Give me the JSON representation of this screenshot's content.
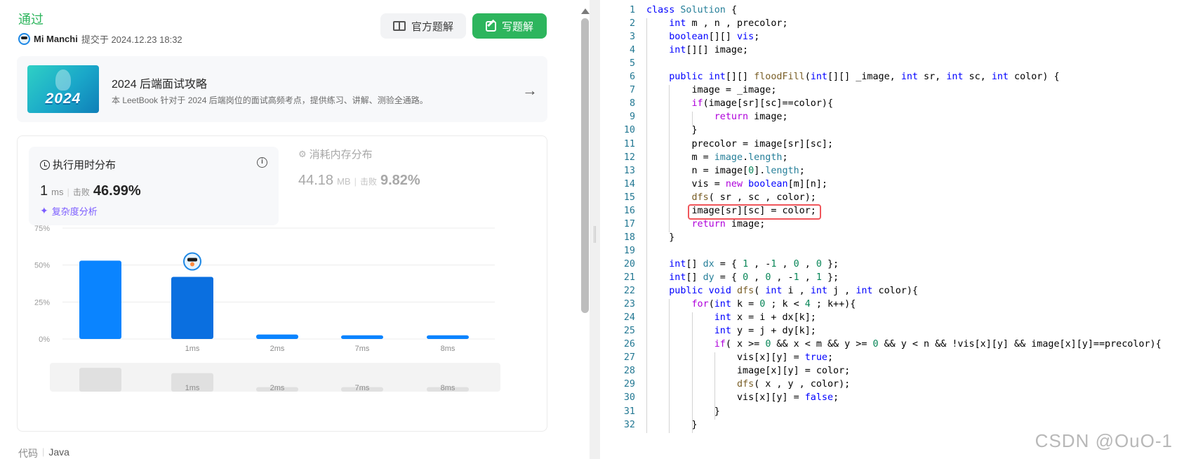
{
  "submission": {
    "status": "通过",
    "user": "Mi Manchi",
    "submitted_at": "提交于 2024.12.23 18:32"
  },
  "actions": {
    "official_solution": "官方题解",
    "write_solution": "写题解"
  },
  "leetbook": {
    "cover_text": "2024",
    "title": "2024 后端面试攻略",
    "description": "本 LeetBook 针对于 2024 后端岗位的面试高频考点，提供练习、讲解、测验全通路。"
  },
  "runtime": {
    "title": "执行用时分布",
    "value": "1",
    "unit": "ms",
    "beat_label": "击败",
    "beat_pct": "46.99%",
    "complexity_link": "复杂度分析"
  },
  "memory": {
    "title": "消耗内存分布",
    "value": "44.18",
    "unit": "MB",
    "beat_label": "击败",
    "beat_pct": "9.82%"
  },
  "chart_data": {
    "type": "bar",
    "categories": [
      "",
      "1ms",
      "2ms",
      "7ms",
      "8ms"
    ],
    "values": [
      53,
      42,
      3,
      2.5,
      2.5
    ],
    "y_ticks": [
      "75%",
      "50%",
      "25%",
      "0%"
    ],
    "ylim": [
      0,
      75
    ],
    "highlight_index": 1,
    "colors": {
      "bar": "#0a84ff",
      "bar_highlight": "#0a6fe0",
      "overview": "#e0e0e0"
    },
    "overview_values": [
      32,
      25,
      6,
      6,
      6
    ],
    "overview_labels": [
      "",
      "1ms",
      "2ms",
      "7ms",
      "8ms"
    ]
  },
  "footer": {
    "code_label": "代码",
    "language": "Java"
  },
  "editor": {
    "watermark": "CSDN @OuO-1",
    "lines": [
      {
        "n": "1",
        "t": [
          [
            "kw",
            "class "
          ],
          [
            "ty",
            "Solution "
          ],
          [
            "",
            "{"
          ]
        ]
      },
      {
        "n": "2",
        "t": [
          [
            "",
            "    "
          ],
          [
            "kw",
            "int"
          ],
          [
            "",
            " m , n , precolor;"
          ]
        ]
      },
      {
        "n": "3",
        "t": [
          [
            "",
            "    "
          ],
          [
            "kw",
            "boolean"
          ],
          [
            "",
            "[][] "
          ],
          [
            "kw",
            "vis"
          ],
          [
            "",
            ";"
          ]
        ]
      },
      {
        "n": "4",
        "t": [
          [
            "",
            "    "
          ],
          [
            "kw",
            "int"
          ],
          [
            "",
            "[][] image;"
          ]
        ]
      },
      {
        "n": "5",
        "t": [
          [
            "",
            ""
          ]
        ]
      },
      {
        "n": "6",
        "t": [
          [
            "",
            "    "
          ],
          [
            "kw",
            "public int"
          ],
          [
            "",
            "[][] "
          ],
          [
            "fn",
            "floodFill"
          ],
          [
            "",
            "("
          ],
          [
            "kw",
            "int"
          ],
          [
            "",
            "[][] _image, "
          ],
          [
            "kw",
            "int"
          ],
          [
            "",
            " sr, "
          ],
          [
            "kw",
            "int"
          ],
          [
            "",
            " sc, "
          ],
          [
            "kw",
            "int"
          ],
          [
            "",
            " color) {"
          ]
        ]
      },
      {
        "n": "7",
        "t": [
          [
            "",
            "        image = _image;"
          ]
        ]
      },
      {
        "n": "8",
        "t": [
          [
            "",
            "        "
          ],
          [
            "ctl",
            "if"
          ],
          [
            "",
            "(image[sr][sc]==color){"
          ]
        ]
      },
      {
        "n": "9",
        "t": [
          [
            "",
            "            "
          ],
          [
            "ctl",
            "return"
          ],
          [
            "",
            " image;"
          ]
        ]
      },
      {
        "n": "10",
        "t": [
          [
            "",
            "        }"
          ]
        ]
      },
      {
        "n": "11",
        "t": [
          [
            "",
            "        precolor = image[sr][sc];"
          ]
        ]
      },
      {
        "n": "12",
        "t": [
          [
            "",
            "        m = "
          ],
          [
            "ty",
            "image"
          ],
          [
            "",
            "."
          ],
          [
            "ty",
            "length"
          ],
          [
            "",
            ";"
          ]
        ]
      },
      {
        "n": "13",
        "t": [
          [
            "",
            "        n = image["
          ],
          [
            "nm",
            "0"
          ],
          [
            "",
            "]."
          ],
          [
            "ty",
            "length"
          ],
          [
            "",
            ";"
          ]
        ]
      },
      {
        "n": "14",
        "t": [
          [
            "",
            "        vis = "
          ],
          [
            "ctl",
            "new "
          ],
          [
            "kw",
            "boolean"
          ],
          [
            "",
            "[m][n];"
          ]
        ]
      },
      {
        "n": "15",
        "t": [
          [
            "",
            "        "
          ],
          [
            "fn",
            "dfs"
          ],
          [
            "",
            "( sr , sc , color);"
          ]
        ]
      },
      {
        "n": "16",
        "t": [
          [
            "",
            "        image[sr][sc] = color;"
          ]
        ]
      },
      {
        "n": "17",
        "t": [
          [
            "",
            "        "
          ],
          [
            "ctl",
            "return"
          ],
          [
            "",
            " image;"
          ]
        ]
      },
      {
        "n": "18",
        "t": [
          [
            "",
            "    }"
          ]
        ]
      },
      {
        "n": "19",
        "t": [
          [
            "",
            ""
          ]
        ]
      },
      {
        "n": "20",
        "t": [
          [
            "",
            "    "
          ],
          [
            "kw",
            "int"
          ],
          [
            "",
            "[] "
          ],
          [
            "ty",
            "dx"
          ],
          [
            "",
            " = { "
          ],
          [
            "nm",
            "1"
          ],
          [
            "",
            " , -"
          ],
          [
            "nm",
            "1"
          ],
          [
            "",
            " , "
          ],
          [
            "nm",
            "0"
          ],
          [
            "",
            " , "
          ],
          [
            "nm",
            "0"
          ],
          [
            "",
            " };"
          ]
        ]
      },
      {
        "n": "21",
        "t": [
          [
            "",
            "    "
          ],
          [
            "kw",
            "int"
          ],
          [
            "",
            "[] "
          ],
          [
            "ty",
            "dy"
          ],
          [
            "",
            " = { "
          ],
          [
            "nm",
            "0"
          ],
          [
            "",
            " , "
          ],
          [
            "nm",
            "0"
          ],
          [
            "",
            " , -"
          ],
          [
            "nm",
            "1"
          ],
          [
            "",
            " , "
          ],
          [
            "nm",
            "1"
          ],
          [
            "",
            " };"
          ]
        ]
      },
      {
        "n": "22",
        "t": [
          [
            "",
            "    "
          ],
          [
            "kw",
            "public void "
          ],
          [
            "fn",
            "dfs"
          ],
          [
            "",
            "( "
          ],
          [
            "kw",
            "int"
          ],
          [
            "",
            " i , "
          ],
          [
            "kw",
            "int"
          ],
          [
            "",
            " j , "
          ],
          [
            "kw",
            "int"
          ],
          [
            "",
            " color){"
          ]
        ]
      },
      {
        "n": "23",
        "t": [
          [
            "",
            "        "
          ],
          [
            "ctl",
            "for"
          ],
          [
            "",
            "("
          ],
          [
            "kw",
            "int"
          ],
          [
            "",
            " k = "
          ],
          [
            "nm",
            "0"
          ],
          [
            "",
            " ; k < "
          ],
          [
            "nm",
            "4"
          ],
          [
            "",
            " ; k++){"
          ]
        ]
      },
      {
        "n": "24",
        "t": [
          [
            "",
            "            "
          ],
          [
            "kw",
            "int"
          ],
          [
            "",
            " x = i + dx[k];"
          ]
        ]
      },
      {
        "n": "25",
        "t": [
          [
            "",
            "            "
          ],
          [
            "kw",
            "int"
          ],
          [
            "",
            " y = j + dy[k];"
          ]
        ]
      },
      {
        "n": "26",
        "t": [
          [
            "",
            "            "
          ],
          [
            "ctl",
            "if"
          ],
          [
            "",
            "( x >= "
          ],
          [
            "nm",
            "0"
          ],
          [
            "",
            " && x < m && y >= "
          ],
          [
            "nm",
            "0"
          ],
          [
            "",
            " && y < n && !vis[x][y] && image[x][y]==precolor){"
          ]
        ]
      },
      {
        "n": "27",
        "t": [
          [
            "",
            "                vis[x][y] = "
          ],
          [
            "kw",
            "true"
          ],
          [
            "",
            ";"
          ]
        ]
      },
      {
        "n": "28",
        "t": [
          [
            "",
            "                image[x][y] = color;"
          ]
        ]
      },
      {
        "n": "29",
        "t": [
          [
            "",
            "                "
          ],
          [
            "fn",
            "dfs"
          ],
          [
            "",
            "( x , y , color);"
          ]
        ]
      },
      {
        "n": "30",
        "t": [
          [
            "",
            "                vis[x][y] = "
          ],
          [
            "kw",
            "false"
          ],
          [
            "",
            ";"
          ]
        ]
      },
      {
        "n": "31",
        "t": [
          [
            "",
            "            }"
          ]
        ]
      },
      {
        "n": "32",
        "t": [
          [
            "",
            "        }"
          ]
        ]
      }
    ]
  }
}
